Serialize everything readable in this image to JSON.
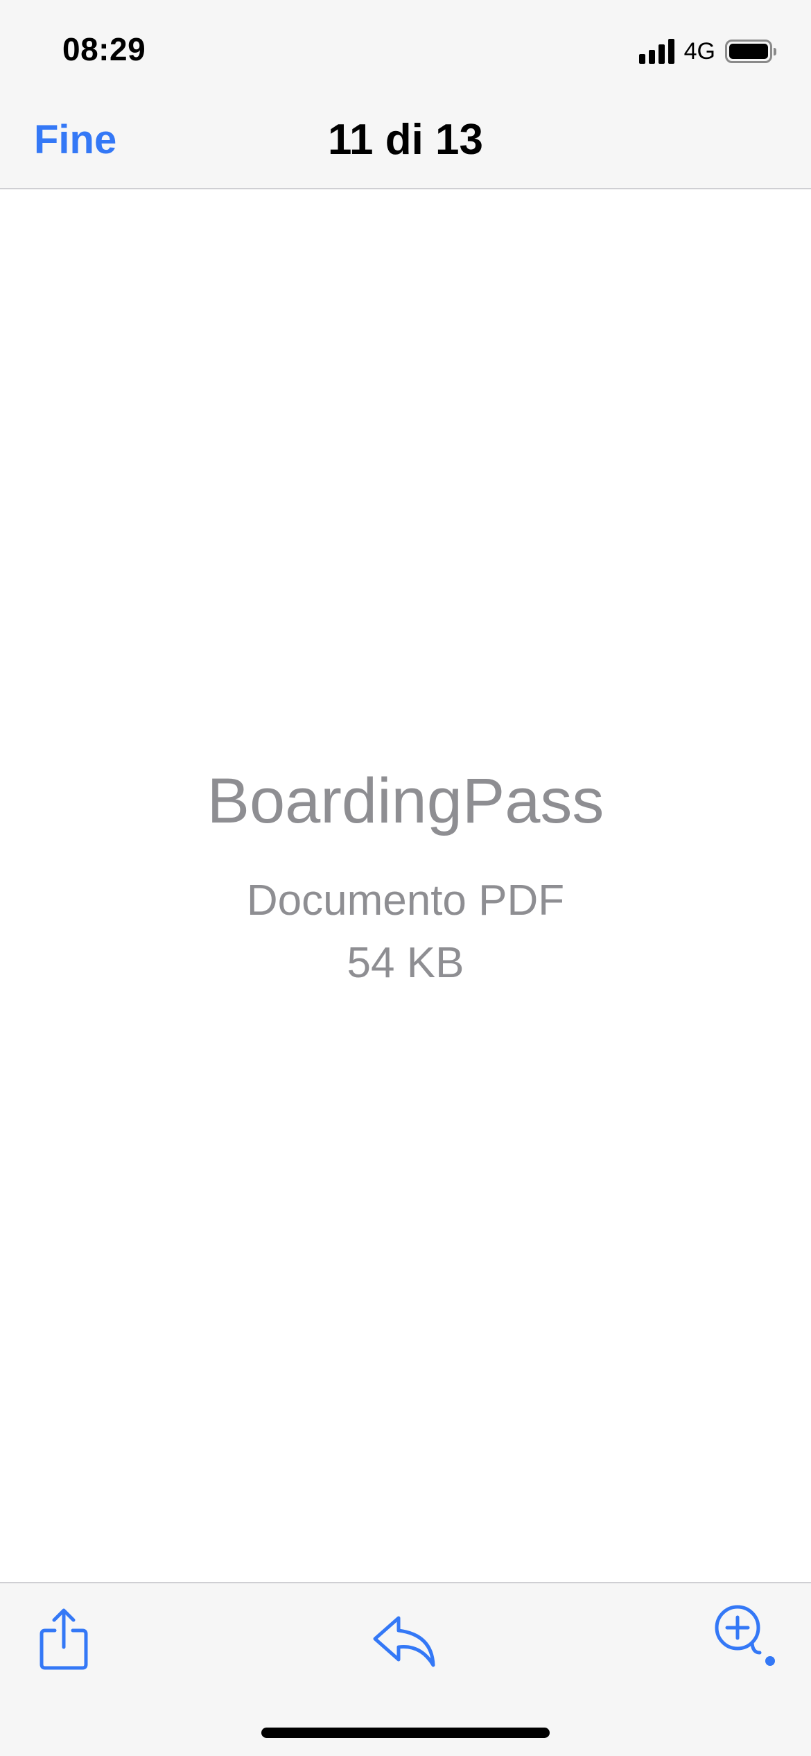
{
  "status_bar": {
    "time": "08:29",
    "network": "4G",
    "icons": [
      "signal-icon",
      "battery-icon"
    ]
  },
  "nav": {
    "done_label": "Fine",
    "title": "11 di 13"
  },
  "file": {
    "name": "BoardingPass",
    "type": "Documento PDF",
    "size": "54 KB"
  },
  "toolbar": {
    "icons": [
      "share-icon",
      "reply-icon",
      "zoom-in-icon"
    ]
  },
  "colors": {
    "accent": "#3478f6",
    "secondary_text": "#8e8e92",
    "bar_background": "#f6f6f6"
  }
}
